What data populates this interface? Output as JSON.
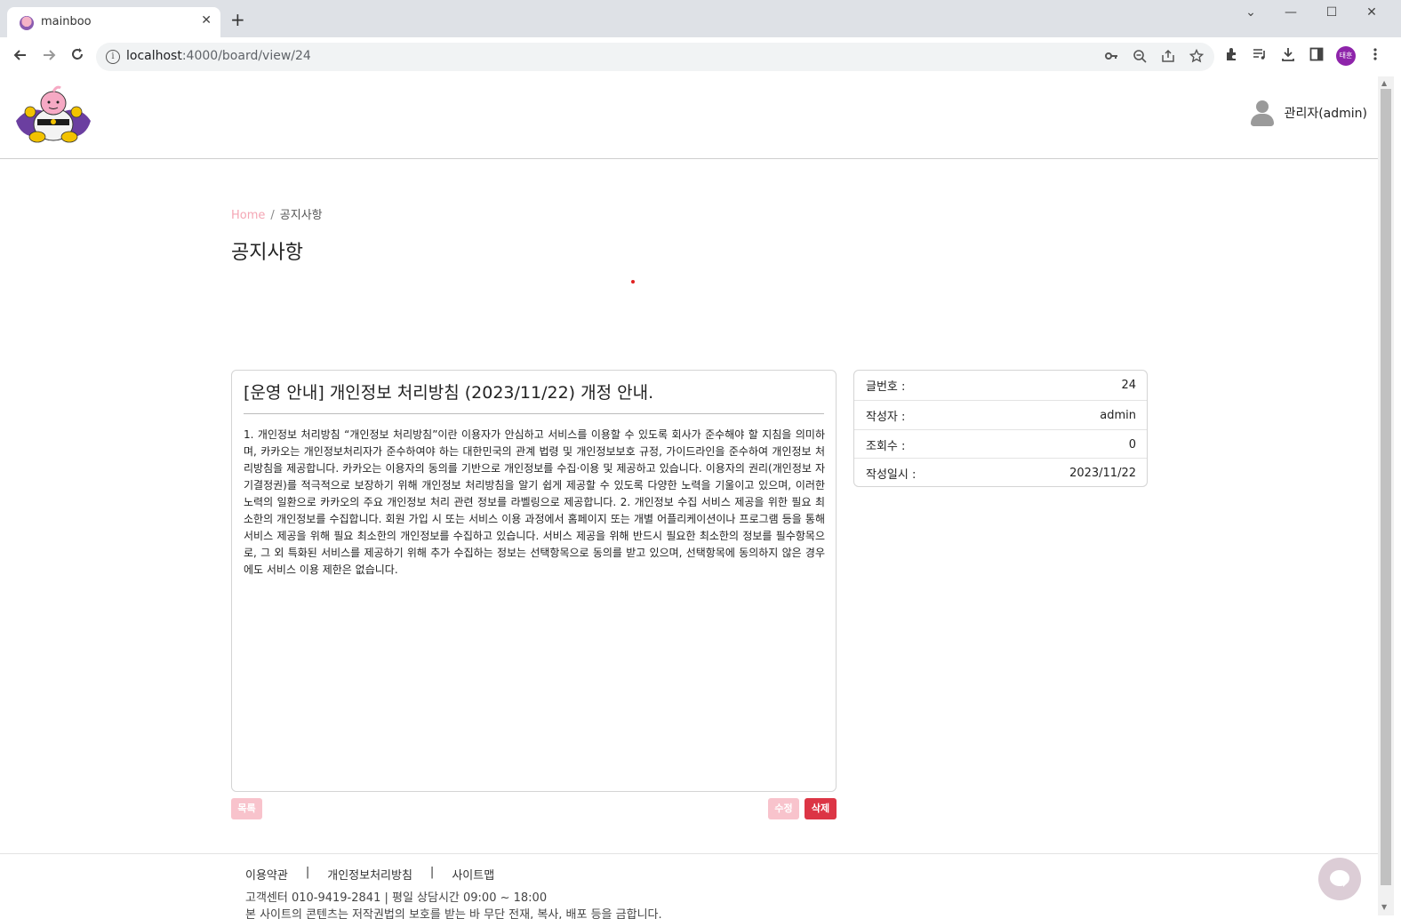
{
  "browser": {
    "tab_title": "mainboo",
    "tab_close": "✕",
    "new_tab": "+",
    "url_host": "localhost",
    "url_path": ":4000/board/view/24",
    "profile_initials": "태훈",
    "window_controls": [
      "⌄",
      "—",
      "☐",
      "✕"
    ]
  },
  "header": {
    "user_name": "관리자(admin)"
  },
  "breadcrumb": {
    "home": "Home",
    "separator": "/",
    "current": "공지사항"
  },
  "page": {
    "title": "공지사항"
  },
  "post": {
    "title": "[운영 안내] 개인정보 처리방침 (2023/11/22) 개정 안내.",
    "body": "1. 개인정보 처리방침 “개인정보 처리방침”이란 이용자가 안심하고 서비스를 이용할 수 있도록 회사가 준수해야 할 지침을 의미하며, 카카오는 개인정보처리자가 준수하여야 하는 대한민국의 관계 법령 및 개인정보보호 규정, 가이드라인을 준수하여 개인정보 처리방침을 제공합니다. 카카오는 이용자의 동의를 기반으로 개인정보를 수집·이용 및 제공하고 있습니다. 이용자의 권리(개인정보 자기결정권)를 적극적으로 보장하기 위해 개인정보 처리방침을 알기 쉽게 제공할 수 있도록 다양한 노력을 기울이고 있으며, 이러한 노력의 일환으로 카카오의 주요 개인정보 처리 관련 정보를 라벨링으로 제공합니다. 2. 개인정보 수집 서비스 제공을 위한 필요 최소한의 개인정보를 수집합니다. 회원 가입 시 또는 서비스 이용 과정에서 홈페이지 또는 개별 어플리케이션이나 프로그램 등을 통해 서비스 제공을 위해 필요 최소한의 개인정보를 수집하고 있습니다. 서비스 제공을 위해 반드시 필요한 최소한의 정보를 필수항목으로, 그 외 특화된 서비스를 제공하기 위해 추가 수집하는 정보는 선택항목으로 동의를 받고 있으며, 선택항목에 동의하지 않은 경우에도 서비스 이용 제한은 없습니다."
  },
  "meta": {
    "rows": [
      {
        "label": "글번호 :",
        "value": "24"
      },
      {
        "label": "작성자 :",
        "value": "admin"
      },
      {
        "label": "조회수 :",
        "value": "0"
      },
      {
        "label": "작성일시 :",
        "value": "2023/11/22"
      }
    ]
  },
  "buttons": {
    "list": "목록",
    "edit": "수정",
    "delete": "삭제"
  },
  "footer": {
    "links": [
      "이용약관",
      "개인정보처리방침",
      "사이트맵"
    ],
    "separator": "|",
    "info": "고객센터 010-9419-2841 | 평일 상담시간 09:00 ~ 18:00",
    "copyright": "본 사이트의 콘텐츠는 저작권법의 보호를 받는 바 무단 전재, 복사, 배포 등을 금합니다."
  },
  "colors": {
    "accent_pink": "#f8c3cc",
    "delete_red": "#dc3545",
    "profile_purple": "#8e24aa"
  },
  "icons": {
    "nav": [
      "back-icon",
      "forward-icon",
      "reload-icon"
    ],
    "omnibox": [
      "key-icon",
      "zoom-out-icon",
      "share-icon",
      "star-icon"
    ],
    "toolbar": [
      "extensions-icon",
      "media-icon",
      "download-icon",
      "sidepanel-icon",
      "menu-icon"
    ]
  }
}
